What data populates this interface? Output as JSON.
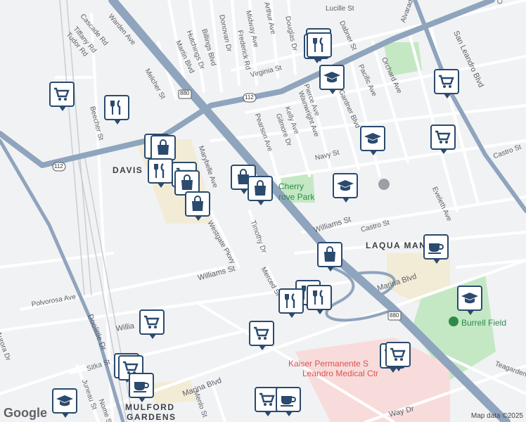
{
  "map": {
    "attribution": "Map data ©2025",
    "logo": "Google",
    "colors": {
      "road_major": "#8fa4bd",
      "road_minor": "#ffffff",
      "park": "#c4e8c4",
      "campus": "#f2ecd6",
      "hospital": "#f8dcdc",
      "marker_border": "#2a4a6e"
    }
  },
  "labels": {
    "streets": [
      "Lucille St",
      "Clarke St",
      "Alvarado St",
      "San Leandro Blvd",
      "Warden Ave",
      "Cascade Rd",
      "Tiffany Rd",
      "Tudor Rd",
      "Melcher St",
      "Martin Blvd",
      "Hutchings Dr",
      "Billings Blvd",
      "Donovan Dr",
      "Frederick Rd",
      "Midway Ave",
      "Arthur Ave",
      "Douglas Dr",
      "Dabner St",
      "Pacific Ave",
      "Orchard Ave",
      "Virginia St",
      "Pierce Ave",
      "Gardner Blvd",
      "Beecher St",
      "Pearson Ave",
      "Gilmore Dr",
      "Kelly Ave",
      "Wainwright Ave",
      "Navy St",
      "Castro St",
      "Marybelle Ave",
      "Williams St",
      "Westgate Pkwy",
      "Timothy Dr",
      "Eveleth Ave",
      "Polvorosa Ave",
      "Merced St",
      "Marina Blvd",
      "Aurora Dr",
      "Doolittle Dr",
      "Sitka St",
      "Juneau St",
      "Nome St",
      "Menlo St",
      "Teagarden St",
      "Way Dr",
      "Willia"
    ],
    "areas": [
      "DAVIS",
      "LAQUA MAN",
      "MULFORD",
      "GARDENS"
    ],
    "parks": [
      "Cherry",
      "rove Park",
      "Burrell Field"
    ],
    "poi": [
      "Kaiser Permanente S",
      "Leandro Medical Ctr"
    ],
    "shields": [
      "880",
      "112",
      "112",
      "880"
    ]
  },
  "markers": {
    "icons": [
      "shopping-cart-icon",
      "utensils-icon",
      "graduation-cap-icon",
      "shopping-bag-icon",
      "coffee-cup-icon"
    ]
  }
}
